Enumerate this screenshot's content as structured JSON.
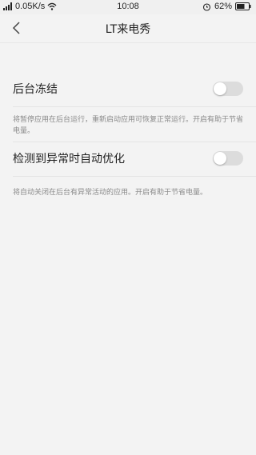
{
  "status_bar": {
    "network_speed": "0.05K/s",
    "time": "10:08",
    "battery_percent": "62%",
    "icons": [
      "signal-icon",
      "wifi-icon",
      "alarm-icon",
      "battery-icon"
    ]
  },
  "header": {
    "title": "LT来电秀",
    "back_icon": "chevron-left-icon"
  },
  "settings": [
    {
      "label": "后台冻结",
      "enabled": false,
      "description": "将暂停应用在后台运行，重新启动应用可恢复正常运行。开启有助于节省电量。"
    },
    {
      "label": "检测到异常时自动优化",
      "enabled": false,
      "description": "将自动关闭在后台有异常活动的应用。开启有助于节省电量。"
    }
  ],
  "colors": {
    "background": "#f3f3f3",
    "toggle_off": "#dcdcdc",
    "description_text": "#8a8a8a"
  }
}
